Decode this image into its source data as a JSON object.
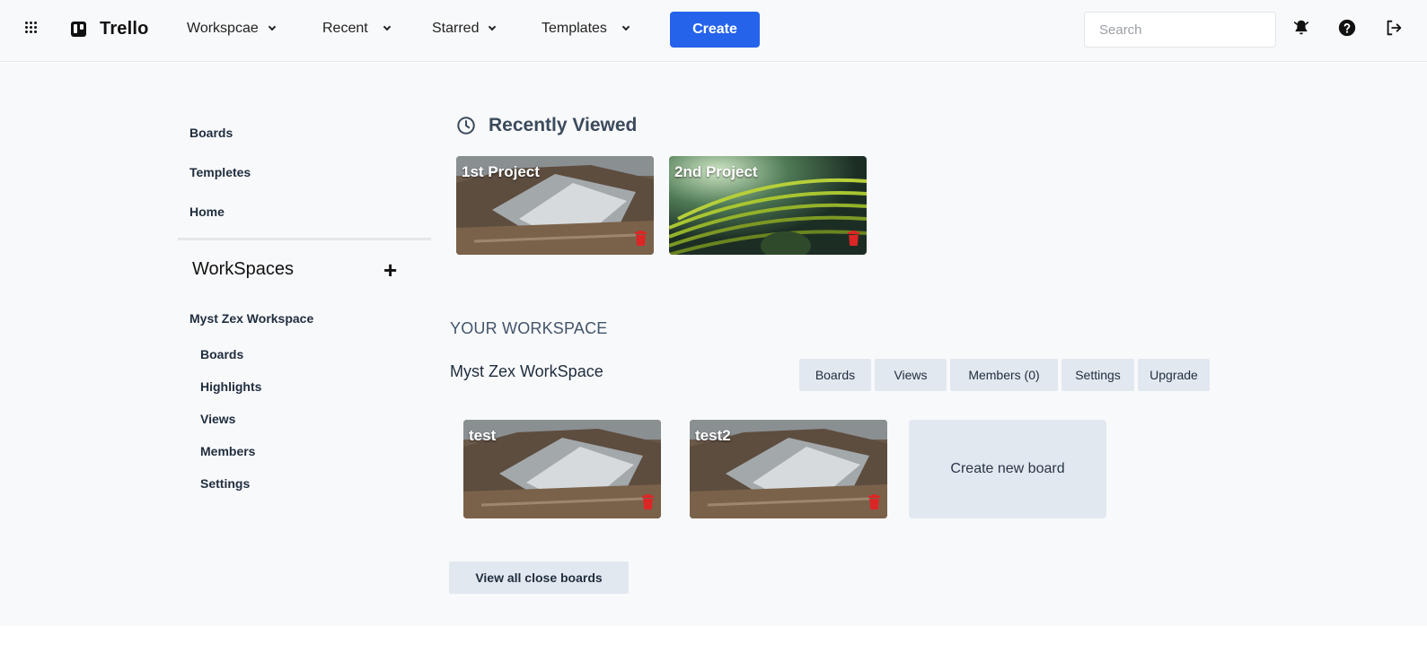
{
  "app": {
    "name": "Trello"
  },
  "nav": {
    "menus": [
      {
        "label": "Workspcae"
      },
      {
        "label": "Recent"
      },
      {
        "label": "Starred"
      },
      {
        "label": "Templates"
      }
    ],
    "create_label": "Create",
    "search_placeholder": "Search",
    "icons": [
      "apps-grid-icon",
      "bell-icon",
      "help-icon",
      "logout-icon"
    ]
  },
  "sidebar": {
    "links": [
      {
        "label": "Boards"
      },
      {
        "label": "Templetes"
      },
      {
        "label": "Home"
      }
    ],
    "workspaces_heading": "WorkSpaces",
    "add_symbol": "+",
    "workspace_name": "Myst Zex Workspace",
    "workspace_links": [
      {
        "label": "Boards"
      },
      {
        "label": "Highlights"
      },
      {
        "label": "Views"
      },
      {
        "label": "Members"
      },
      {
        "label": "Settings"
      }
    ]
  },
  "recently_viewed": {
    "title": "Recently Viewed",
    "boards": [
      {
        "title": "1st Project",
        "image": "rocky-terraced-hillside"
      },
      {
        "title": "2nd Project",
        "image": "green-rice-terraces"
      }
    ]
  },
  "workspace_section": {
    "heading": "YOUR WORKSPACE",
    "name": "Myst Zex WorkSpace",
    "tabs": [
      {
        "label": "Boards"
      },
      {
        "label": "Views"
      },
      {
        "label": "Members (0)"
      },
      {
        "label": "Settings"
      },
      {
        "label": "Upgrade"
      }
    ],
    "boards": [
      {
        "title": "test",
        "image": "rocky-terraced-hillside"
      },
      {
        "title": "test2",
        "image": "rocky-terraced-hillside"
      }
    ],
    "create_board_label": "Create new board",
    "view_closed_label": "View all close boards"
  },
  "colors": {
    "accent": "#2563eb",
    "background": "#f8f9fb",
    "tab_bg": "#e2e8f0",
    "delete": "#dc2626"
  }
}
